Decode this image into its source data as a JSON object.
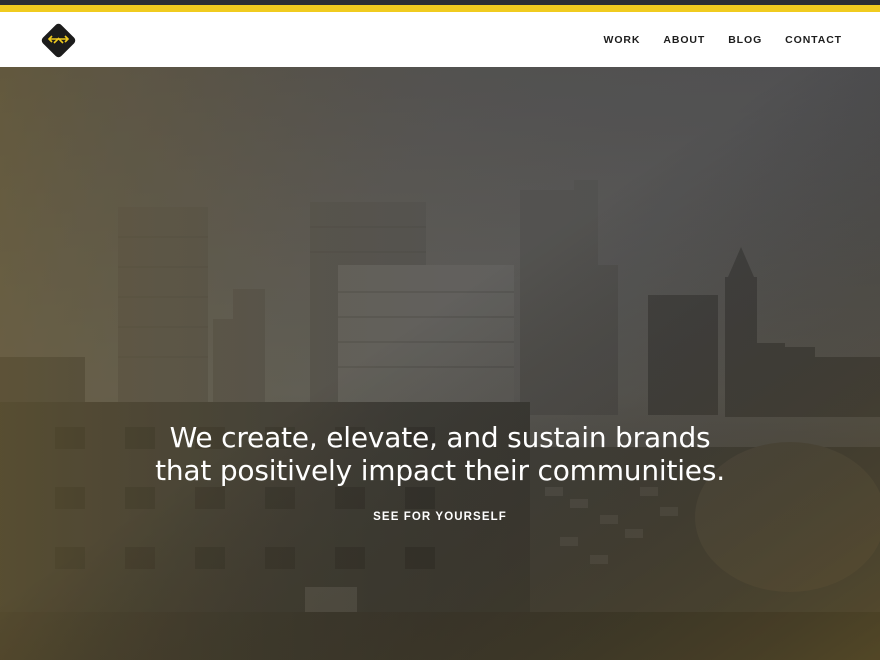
{
  "site": {
    "logo_icon": "diamond-arrows-logo-icon",
    "brand_colors": {
      "stripe_dark": "#2c2f33",
      "stripe_gold": "#f0cb1f",
      "logo_bg": "#1c1c1c"
    }
  },
  "nav": {
    "items": [
      {
        "label": "WORK"
      },
      {
        "label": "ABOUT"
      },
      {
        "label": "BLOG"
      },
      {
        "label": "CONTACT"
      }
    ]
  },
  "hero": {
    "headline_line1": "We create, elevate, and sustain brands",
    "headline_line2": "that positively impact their communities.",
    "cta_label": "SEE FOR YOURSELF",
    "overlay_colors": {
      "left": "#6e5f35",
      "right": "#4a4a4a",
      "bottom": "#5a4d2a"
    }
  }
}
